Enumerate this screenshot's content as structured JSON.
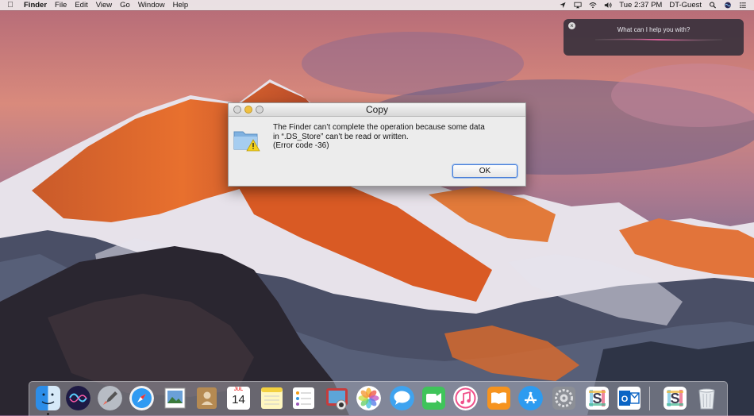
{
  "menubar": {
    "apple_icon": "apple-logo-icon",
    "app_name": "Finder",
    "menus": [
      "File",
      "Edit",
      "View",
      "Go",
      "Window",
      "Help"
    ],
    "clock": "Tue 2:37 PM",
    "user": "DT-Guest",
    "status_icons": [
      "location-icon",
      "airplay-icon",
      "wifi-icon",
      "volume-icon",
      "spotlight-icon",
      "siri-icon",
      "notification-center-icon"
    ]
  },
  "siri": {
    "prompt": "What can I help you with?",
    "close_icon": "close-icon"
  },
  "dialog": {
    "title": "Copy",
    "message_line1": "The Finder can’t complete the operation because some data",
    "message_line2": "in “.DS_Store” can’t be read or written.",
    "message_line3": "(Error code -36)",
    "ok_label": "OK",
    "icon": "folder-warning-icon"
  },
  "dock": {
    "calendar_month": "JUL",
    "calendar_day": "14",
    "items": [
      "finder-icon",
      "siri-icon",
      "launchpad-icon",
      "safari-icon",
      "preview-icon",
      "contacts-icon",
      "calendar-icon",
      "notes-icon",
      "reminders-icon",
      "photo-booth-icon",
      "photos-icon",
      "messages-icon",
      "facetime-icon",
      "itunes-icon",
      "ibooks-icon",
      "app-store-icon",
      "system-preferences-icon",
      "slack-icon",
      "outlook-icon",
      "slack-icon",
      "trash-icon"
    ]
  },
  "colors": {
    "ok_border": "#4a7ed6",
    "minimize_light": "#f0c040",
    "sky_top": "#b46a78",
    "mountain_glow": "#e8602a"
  }
}
